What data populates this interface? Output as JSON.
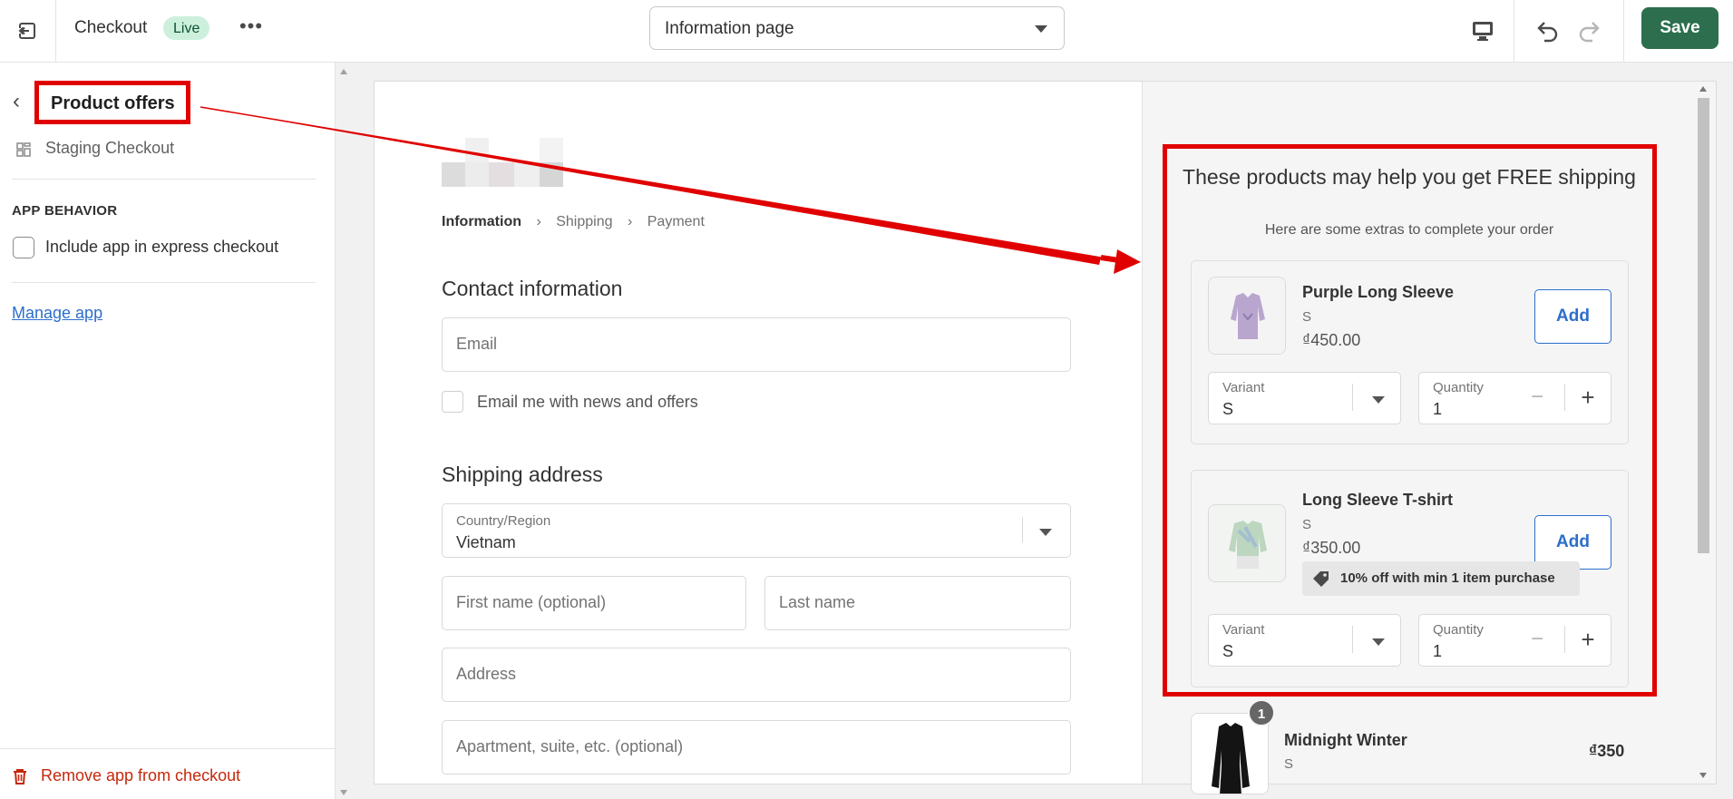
{
  "topbar": {
    "title": "Checkout",
    "status_badge": "Live",
    "more_label": "•••",
    "page_select": "Information page",
    "save_label": "Save"
  },
  "sidebar": {
    "title": "Product offers",
    "staging": "Staging Checkout",
    "section_heading": "APP BEHAVIOR",
    "express_checkbox_label": "Include app in express checkout",
    "manage_link": "Manage app",
    "remove_label": "Remove app from checkout"
  },
  "checkout": {
    "breadcrumbs": [
      "Information",
      "Shipping",
      "Payment"
    ],
    "contact_heading": "Contact information",
    "email_placeholder": "Email",
    "news_checkbox_label": "Email me with news and offers",
    "shipping_heading": "Shipping address",
    "country_label": "Country/Region",
    "country_value": "Vietnam",
    "first_name_placeholder": "First name (optional)",
    "last_name_placeholder": "Last name",
    "address_placeholder": "Address",
    "apartment_placeholder": "Apartment, suite, etc. (optional)"
  },
  "upsell": {
    "title": "These products may help you get FREE shipping",
    "subtitle": "Here are some extras to complete your order",
    "products": [
      {
        "name": "Purple Long Sleeve",
        "variant": "S",
        "price": "₫450.00",
        "add_label": "Add",
        "variant_label": "Variant",
        "variant_value": "S",
        "quantity_label": "Quantity",
        "quantity_value": "1",
        "minus": "−",
        "plus": "+"
      },
      {
        "name": "Long Sleeve T-shirt",
        "variant": "S",
        "price": "₫350.00",
        "add_label": "Add",
        "discount": "10% off with min 1 item purchase",
        "variant_label": "Variant",
        "variant_value": "S",
        "quantity_label": "Quantity",
        "quantity_value": "1",
        "minus": "−",
        "plus": "+"
      }
    ]
  },
  "cart": {
    "quantity_badge": "1",
    "name": "Midnight Winter",
    "variant": "S",
    "price": "₫350"
  },
  "colors": {
    "save_button": "#2c6e4e",
    "live_badge": "#cdf0dc",
    "highlight": "#e00000",
    "link": "#2c6ecb",
    "remove": "#c5280c"
  }
}
